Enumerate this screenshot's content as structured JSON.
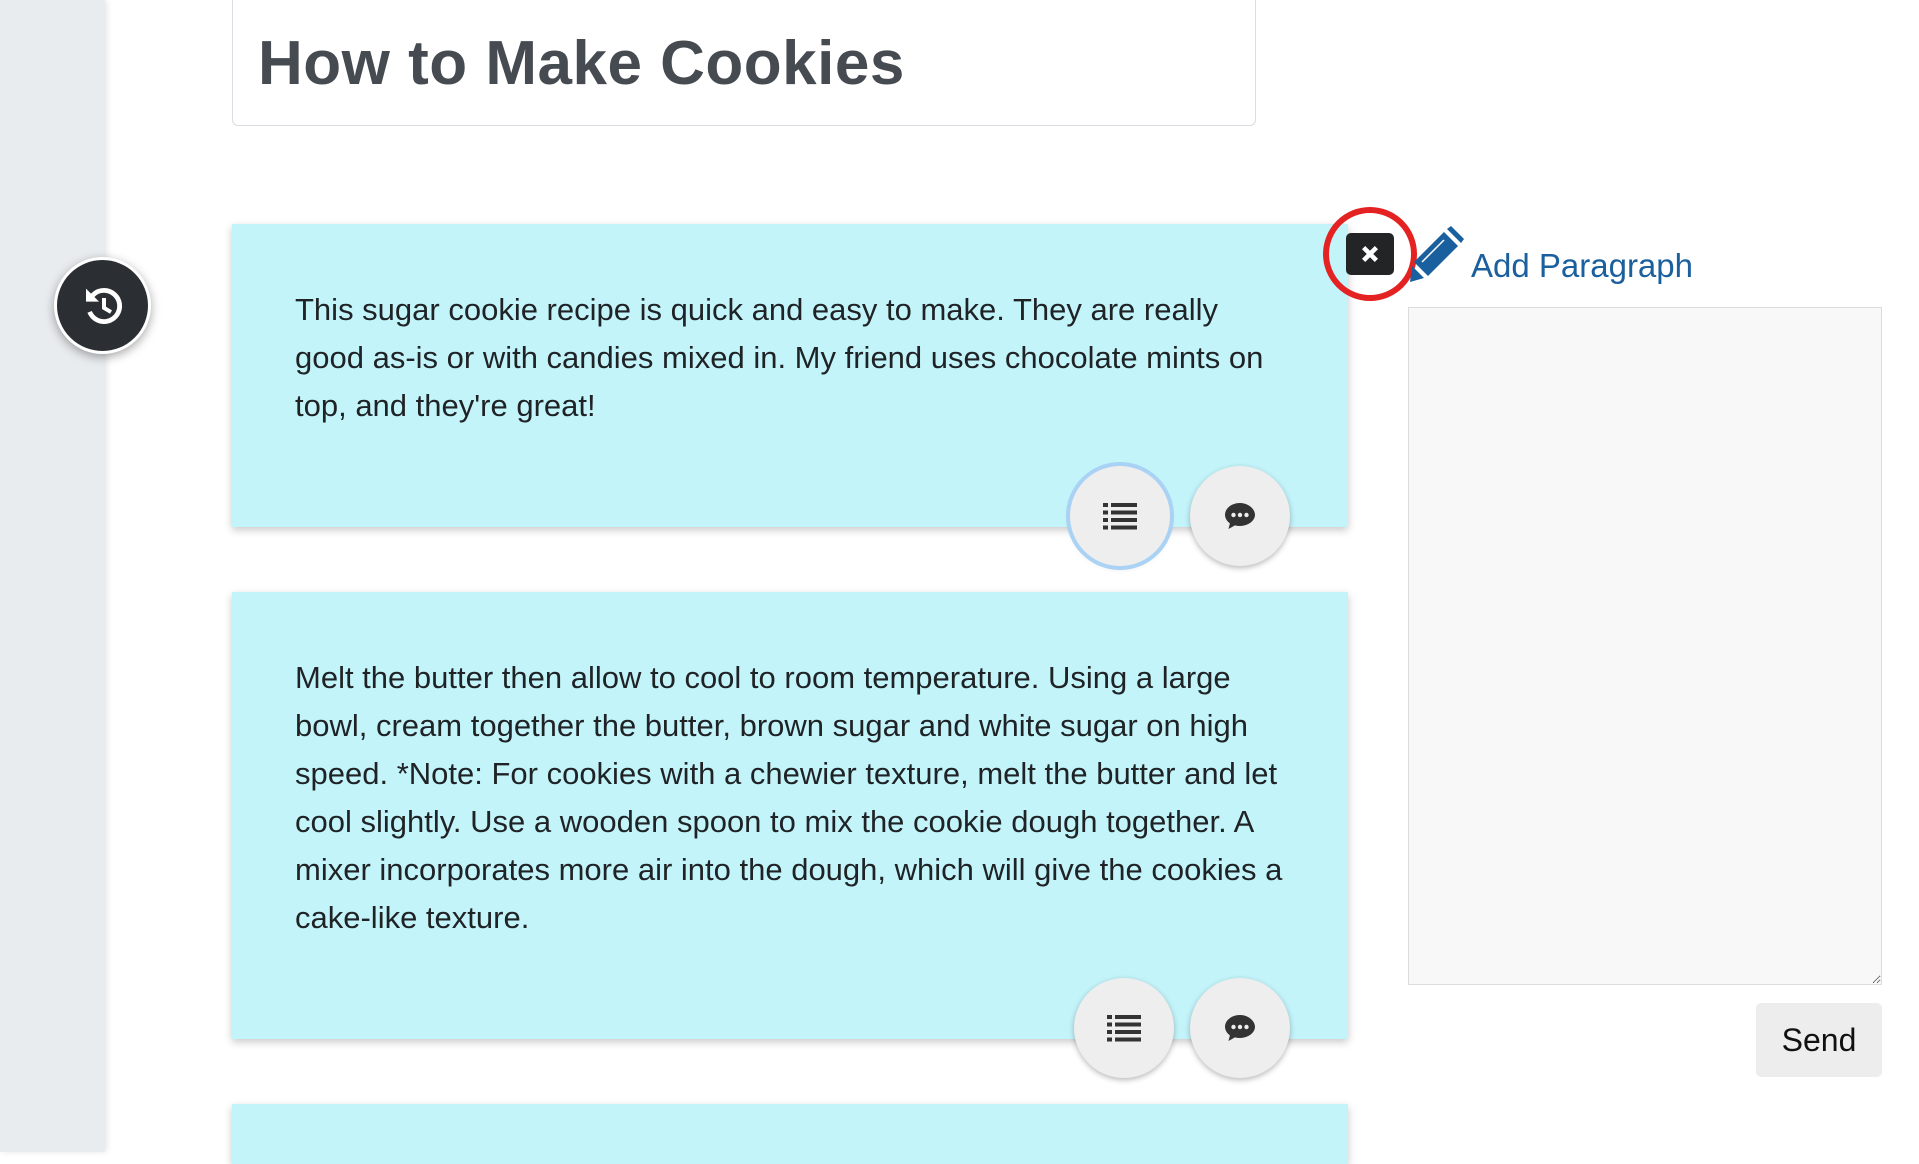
{
  "page": {
    "title": "How to Make Cookies"
  },
  "paragraphs": [
    {
      "text": "This sugar cookie recipe is quick and easy to make. They are really good as-is or with candies mixed in. My friend uses chocolate mints on top, and they're great!"
    },
    {
      "text": "Melt the butter then allow to cool to room temperature. Using a large bowl, cream together the butter, brown sugar and white sugar on high speed. *Note: For cookies with a chewier texture, melt the butter and let cool slightly. Use a wooden spoon to mix the cookie dough together. A mixer incorporates more air into the dough, which will give the cookies a cake-like texture."
    }
  ],
  "editor": {
    "add_paragraph_label": "Add Paragraph",
    "comment_value": "",
    "send_label": "Send"
  },
  "icons": {
    "history": "history-icon",
    "close": "close-icon",
    "pencil": "pencil-icon",
    "list": "list-icon",
    "comment": "comment-icon"
  },
  "colors": {
    "card_background": "#c3f4fa",
    "link": "#1a5f9e",
    "highlight_ring": "#e42222",
    "history_button": "#2b2f33"
  }
}
